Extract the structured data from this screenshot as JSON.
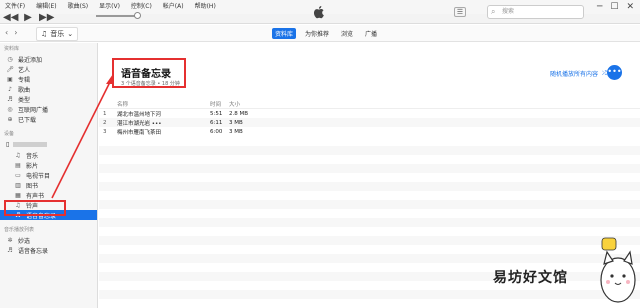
{
  "menu": [
    "文件(F)",
    "编辑(E)",
    "歌曲(S)",
    "显示(V)",
    "控制(C)",
    "帐户(A)",
    "帮助(H)"
  ],
  "search": {
    "placeholder": "搜索"
  },
  "nav": {
    "media_label": "音乐"
  },
  "tabs": [
    {
      "label": "资料库",
      "active": true
    },
    {
      "label": "为你推荐",
      "active": false
    },
    {
      "label": "浏览",
      "active": false
    },
    {
      "label": "广播",
      "active": false
    }
  ],
  "sidebar": {
    "library_header": "资料库",
    "library": [
      {
        "label": "最近添加",
        "icon": "clock-icon"
      },
      {
        "label": "艺人",
        "icon": "microphone-icon"
      },
      {
        "label": "专辑",
        "icon": "album-icon"
      },
      {
        "label": "歌曲",
        "icon": "note-icon"
      },
      {
        "label": "类型",
        "icon": "genre-icon"
      },
      {
        "label": "互联网广播",
        "icon": "radio-icon"
      },
      {
        "label": "已下载",
        "icon": "download-icon"
      }
    ],
    "devices_header": "设备",
    "device_items": [
      {
        "label": "音乐",
        "icon": "note-icon",
        "selected": false
      },
      {
        "label": "影片",
        "icon": "film-icon",
        "selected": false
      },
      {
        "label": "电视节目",
        "icon": "tv-icon",
        "selected": false
      },
      {
        "label": "图书",
        "icon": "book-icon",
        "selected": false
      },
      {
        "label": "有声书",
        "icon": "audiobook-icon",
        "selected": false
      },
      {
        "label": "铃声",
        "icon": "bell-icon",
        "selected": false
      },
      {
        "label": "语音备忘录",
        "icon": "voice-memo-icon",
        "selected": true
      }
    ],
    "playlists_header": "音乐播放列表",
    "playlists": [
      {
        "label": "妙选",
        "icon": "genius-icon"
      },
      {
        "label": "语音备忘录",
        "icon": "voice-memo-icon"
      }
    ]
  },
  "main": {
    "title": "语音备忘录",
    "subtitle": "3 个语音备忘录 • 18 分钟",
    "shuffle_label": "随机播放所有内容",
    "more_label": "•••",
    "columns": {
      "name": "名称",
      "time": "时间",
      "size": "大小"
    },
    "rows": [
      {
        "num": "1",
        "name": "湖北市温州地下河",
        "time": "5:51",
        "size": "2.8 MB"
      },
      {
        "num": "2",
        "name": "湛江市湖光岩 •••",
        "time": "6:11",
        "size": "3 MB"
      },
      {
        "num": "3",
        "name": "梅州市雁南飞茶田",
        "time": "6:00",
        "size": "3 MB"
      }
    ]
  },
  "watermark": "易坊好文馆",
  "colors": {
    "accent": "#1a73e8",
    "highlight": "#e53030"
  }
}
